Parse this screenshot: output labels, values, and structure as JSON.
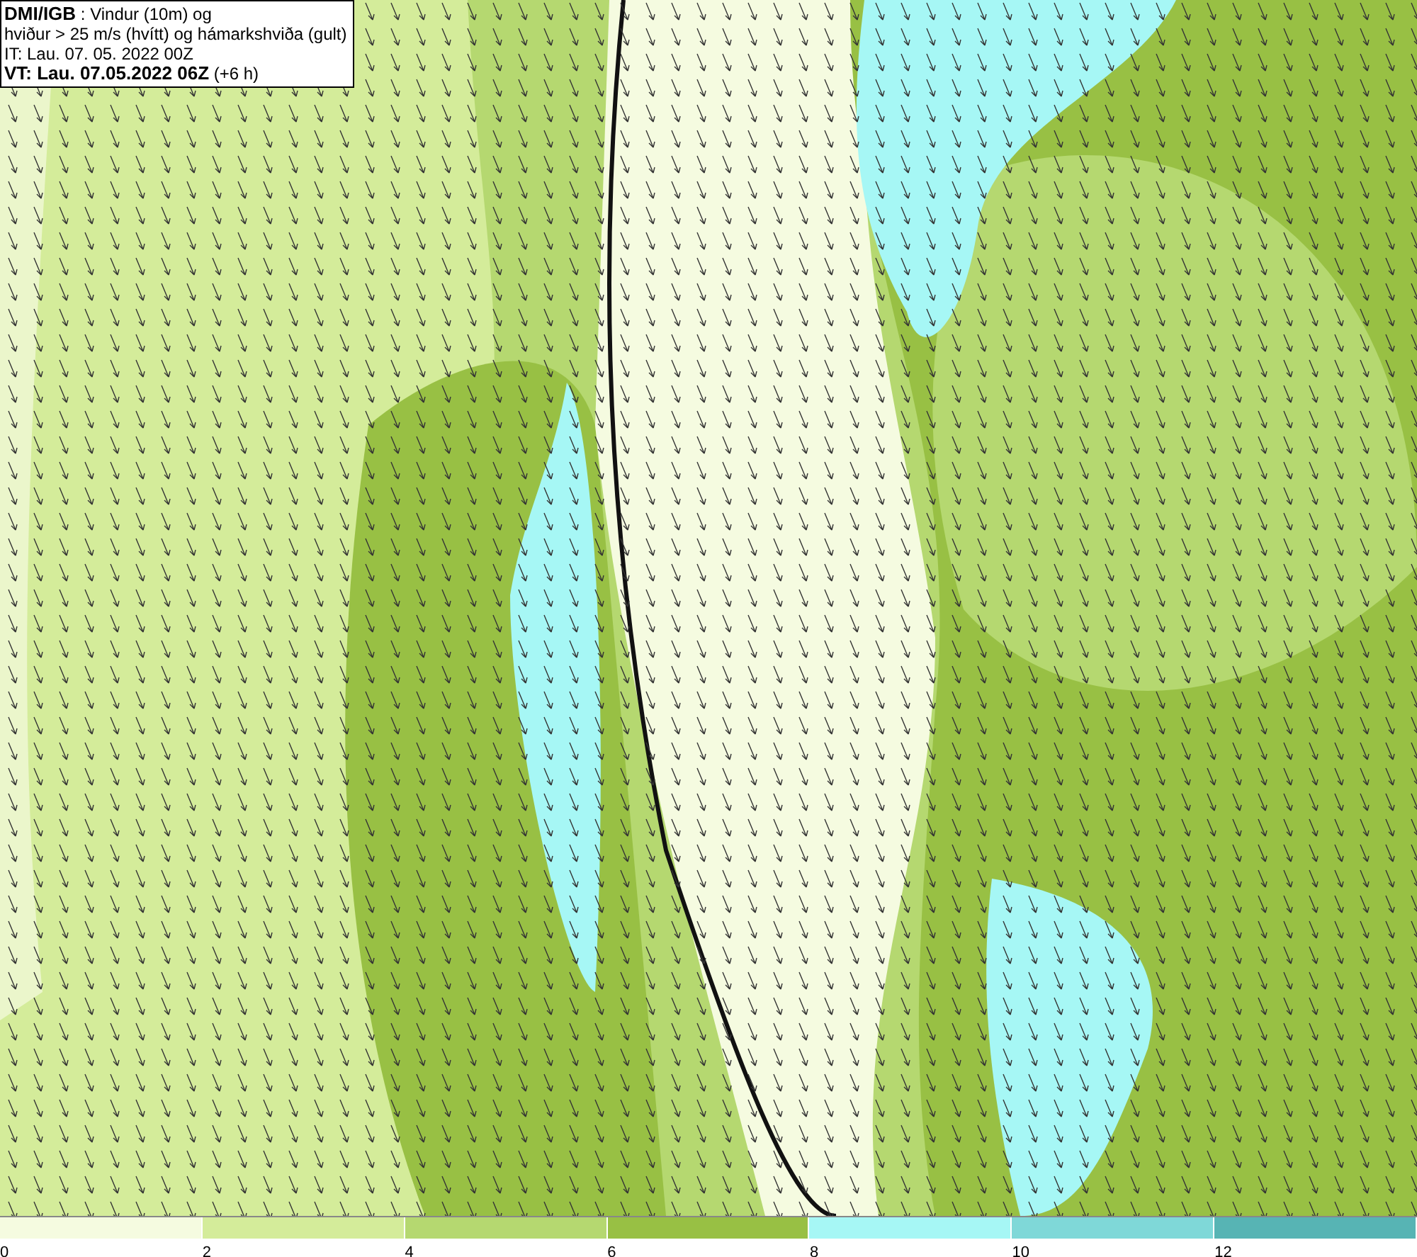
{
  "legend": {
    "lines": [
      "**DMI/IGB** : Vindur (10m) og",
      "hviður > 25 m/s (hvítt) og hámarkshviða (gult)",
      "IT: Lau. 07. 05. 2022 00Z",
      "**VT: Lau. 07.05.2022 06Z** (+6 h)"
    ]
  },
  "colorbar": {
    "segments": [
      {
        "color": "#f5fbe0",
        "label": "0"
      },
      {
        "color": "#d4ec9a",
        "label": "2"
      },
      {
        "color": "#b5d870",
        "label": "4"
      },
      {
        "color": "#98c044",
        "label": "6"
      },
      {
        "color": "#a6f7f5",
        "label": "8"
      },
      {
        "color": "#7fd8d8",
        "label": "10"
      },
      {
        "color": "#57b4b4",
        "label": "12"
      }
    ]
  }
}
